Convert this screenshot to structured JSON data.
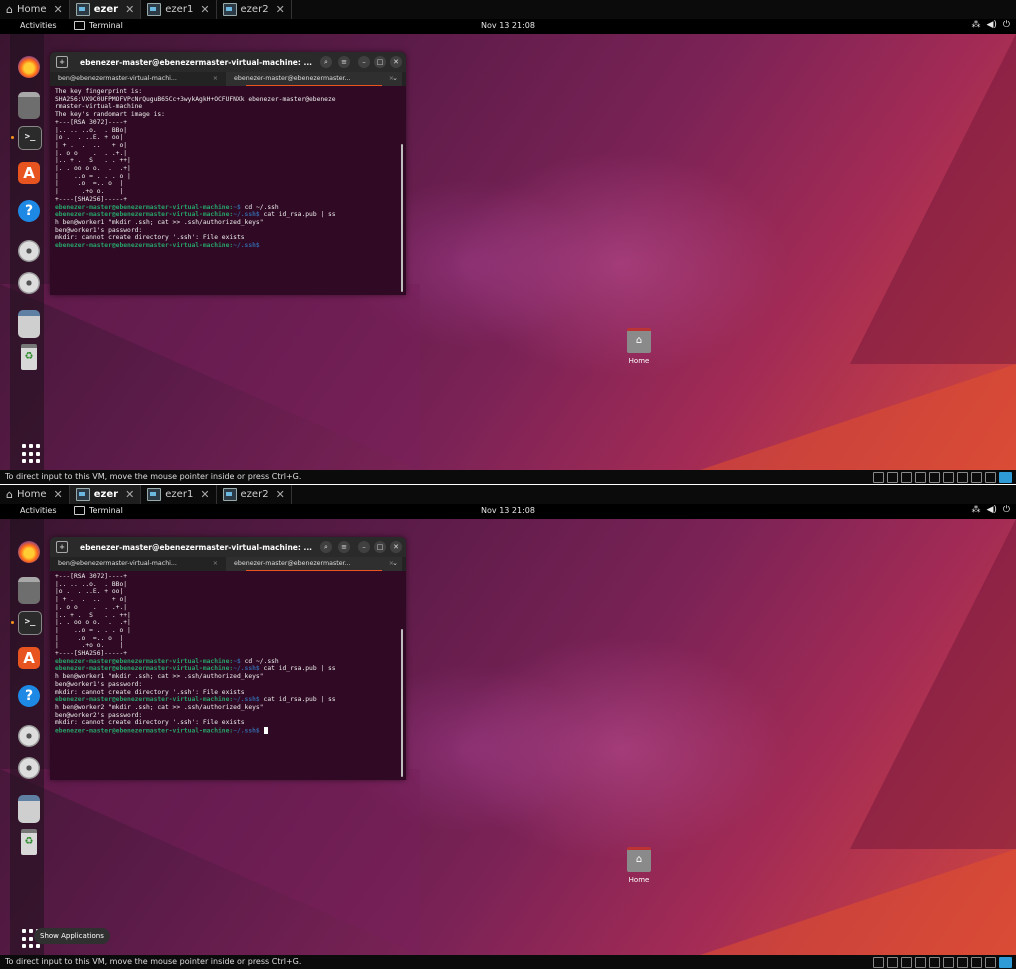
{
  "vmware": {
    "tabs": [
      {
        "label": "Home",
        "icon": "home-icon",
        "active": false
      },
      {
        "label": "ezer",
        "icon": "vm-icon",
        "active": true
      },
      {
        "label": "ezer1",
        "icon": "vm-icon",
        "active": false
      },
      {
        "label": "ezer2",
        "icon": "vm-icon",
        "active": false
      }
    ],
    "close_glyph": "✕",
    "status_message": "To direct input to this VM, move the mouse pointer inside or press Ctrl+G."
  },
  "topbar": {
    "activities": "Activities",
    "app_name": "Terminal",
    "clock": "Nov 13 21:08",
    "sys_icons": [
      "network-icon",
      "volume-icon",
      "power-icon"
    ]
  },
  "dock": {
    "items": [
      "firefox-icon",
      "files-icon",
      "terminal-icon",
      "app-center-icon",
      "help-icon",
      "disc-icon",
      "disc-icon",
      "floppy-icon",
      "trash-icon"
    ],
    "show_apps_tooltip": "Show Applications"
  },
  "desktop": {
    "home_label": "Home"
  },
  "terminal": {
    "title": "ebenezer-master@ebenezermaster-virtual-machine: ...",
    "tabs": [
      {
        "label": "ben@ebenezermaster-virtual-machi...",
        "active": false
      },
      {
        "label": "ebenezer-master@ebenezermaster...",
        "active": true
      }
    ],
    "prompt_user": "ebenezer-master@ebenezermaster-virtual-machine:",
    "prompt_home": "~$",
    "prompt_ssh": "~/.ssh$",
    "shotA_lines": [
      "The key fingerprint is:",
      "SHA256:VX9C0UFPMOFVPcNrQuguB65Cc+3wykAgkH+OCFUFNXk ebenezer-master@ebeneze",
      "rmaster-virtual-machine",
      "The key's randomart image is:",
      "+---[RSA 3072]----+",
      "|.. .. ..o.  . BBo|",
      "|o .  . ..E. + oo|",
      "| + .  .  ..   + o|",
      "|. o o    .  . .+.|",
      "|.. + .  S   . . ++|",
      "|. . oo o o.  .  .+|",
      "|    ..o = . . . o |",
      "|     .o  =.. o  |",
      "|      .+o o.    |",
      "+----[SHA256]-----+"
    ],
    "shotA_cmds": {
      "cd": "cd ~/.ssh",
      "cat1a": "cat id_rsa.pub | ss",
      "cat1b": "h ben@worker1 \"mkdir .ssh; cat >> .ssh/authorized_keys\"",
      "pw1": "ben@worker1's password:",
      "err1": "mkdir: cannot create directory '.ssh': File exists"
    },
    "shotB_lines": [
      "+---[RSA 3072]----+",
      "|.. .. ..o.  . BBo|",
      "|o .  . ..E. + oo|",
      "| + .  .  ..   + o|",
      "|. o o    .  . .+.|",
      "|.. + .  S   . . ++|",
      "|. . oo o o.  .  .+|",
      "|    ..o = . . . o |",
      "|     .o  =.. o  |",
      "|      .+o o.    |",
      "+----[SHA256]-----+"
    ],
    "shotB_cmds": {
      "cd": "cd ~/.ssh",
      "cat1a": "cat id_rsa.pub | ss",
      "cat1b": "h ben@worker1 \"mkdir .ssh; cat >> .ssh/authorized_keys\"",
      "pw1": "ben@worker1's password:",
      "err1": "mkdir: cannot create directory '.ssh': File exists",
      "cat2a": "cat id_rsa.pub | ss",
      "cat2b": "h ben@worker2 \"mkdir .ssh; cat >> .ssh/authorized_keys\"",
      "pw2": "ben@worker2's password:",
      "err2": "mkdir: cannot create directory '.ssh': File exists"
    }
  }
}
